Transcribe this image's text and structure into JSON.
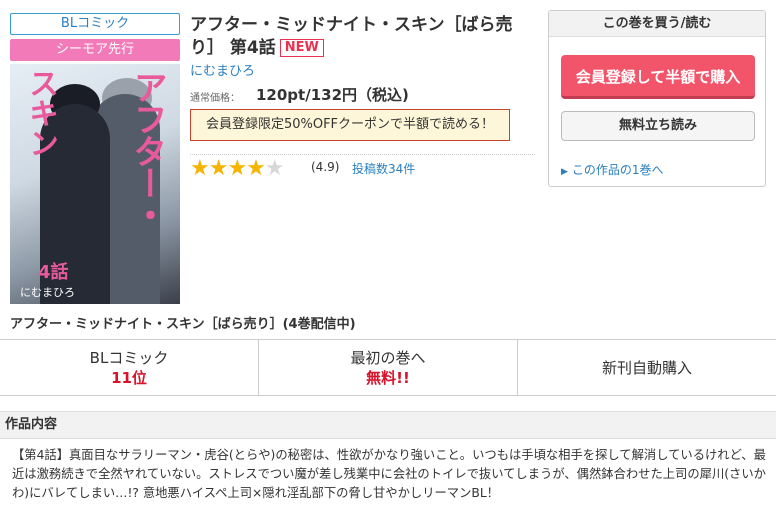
{
  "badges": {
    "genre": "BLコミック",
    "label": "シーモア先行"
  },
  "cover": {
    "title_a": "アフター・",
    "title_b": "スキン",
    "volume": "4話",
    "author": "にむまひろ"
  },
  "cover_caption": "アフター・ミッドナイト・スキン［ばら売り］(4巻配信中)",
  "product": {
    "title": "アフター・ミッドナイト・スキン［ばら売り］ 第4話",
    "new_badge": "NEW",
    "author": "にむまひろ",
    "price_label": "通常価格：",
    "price": "120pt/132円（税込)",
    "coupon": "会員登録限定50%OFFクーポンで半額で読める！",
    "stars": "★★★★",
    "half_star": "★",
    "rating": "(4.9)",
    "reviews": "投稿数34件"
  },
  "buy_box": {
    "heading": "この巻を買う/読む",
    "register_button": "会員登録して半額で購入",
    "trial_button": "無料立ち読み",
    "first_volume_link": "この作品の1巻へ"
  },
  "stats": [
    {
      "label": "BLコミック",
      "value": "11位"
    },
    {
      "label": "最初の巻へ",
      "value": "無料!!"
    },
    {
      "label": "新刊自動購入",
      "value": ""
    }
  ],
  "description": {
    "heading": "作品内容",
    "text": "【第4話】真面目なサラリーマン・虎谷(とらや)の秘密は、性欲がかなり強いこと。いつもは手頃な相手を探して解消しているけれど、最近は激務続きで全然ヤれていない。ストレスでつい魔が差し残業中に会社のトイレで抜いてしまうが、偶然鉢合わせた上司の犀川(さいかわ)にバレてしまい…!? 意地悪ハイスペ上司×隠れ淫乱部下の脅し甘やかしリーマンBL！"
  },
  "colors": {
    "accent_pink": "#f2546a",
    "link_blue": "#2a7fc0",
    "rank_red": "#d8132b",
    "star": "#f5b400"
  }
}
